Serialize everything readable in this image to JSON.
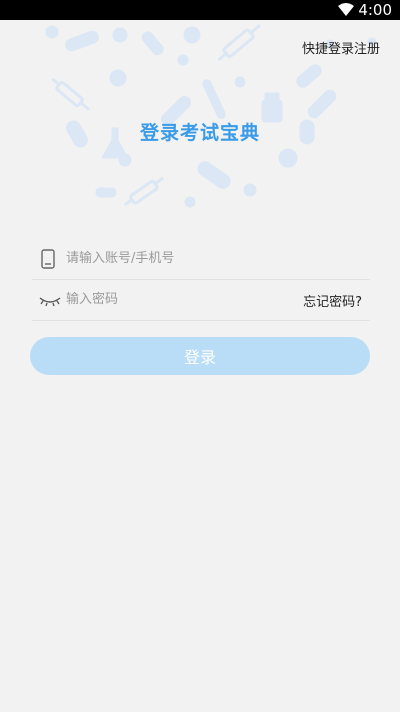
{
  "status_bar": {
    "time": "4:00"
  },
  "header": {
    "quick_register": "快捷登录注册"
  },
  "app": {
    "title": "登录考试宝典"
  },
  "form": {
    "account_placeholder": "请输入账号/手机号",
    "password_placeholder": "输入密码",
    "forgot_label": "忘记密码?",
    "login_label": "登录"
  },
  "icons": {
    "wifi": "wifi-icon",
    "phone": "phone-icon",
    "eye_closed": "eye-closed-icon"
  },
  "colors": {
    "accent": "#3a9be6",
    "button_bg": "#b9dcf7",
    "background": "#f2f2f2",
    "decor": "#dbe7f4"
  }
}
